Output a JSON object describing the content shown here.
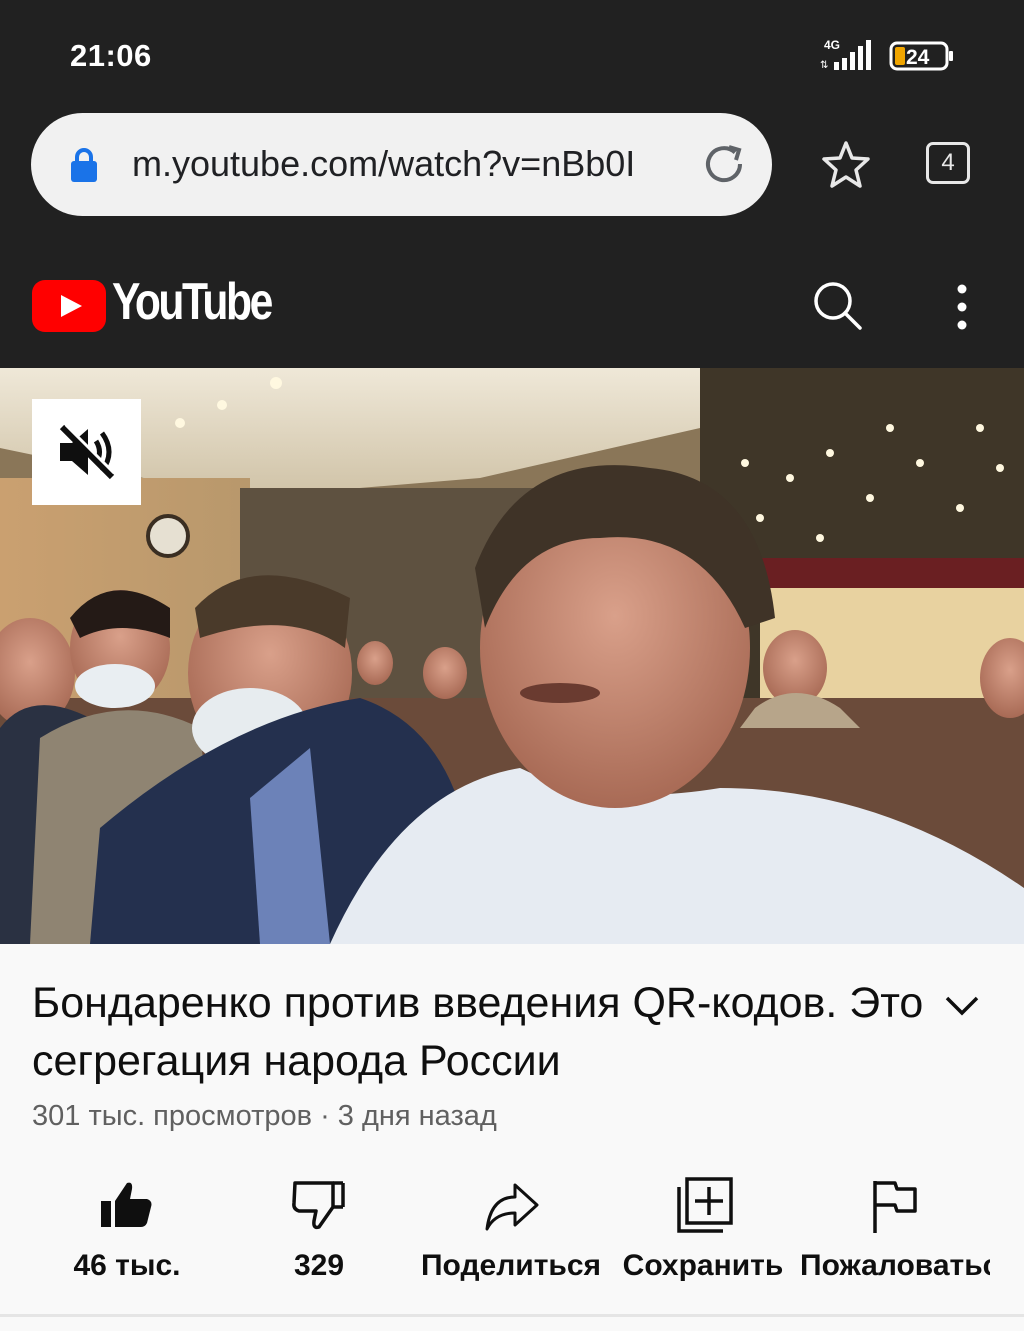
{
  "status": {
    "time": "21:06",
    "network": "4G",
    "battery": "24"
  },
  "browser": {
    "url": "m.youtube.com/watch?v=nBb0I",
    "tab_count": "4"
  },
  "header": {
    "logo_text": "YouTube"
  },
  "video": {
    "title": "Бондаренко против введения QR-кодов. Это сегрегация народа России",
    "meta": "301 тыс. просмотров · 3 дня назад"
  },
  "actions": {
    "like": "46 тыс.",
    "dislike": "329",
    "share": "Поделиться",
    "save": "Сохранить",
    "report": "Пожаловаться"
  },
  "colors": {
    "brand": "#ff0000",
    "chrome_bg": "#212121",
    "omnibox": "#f1f1f1",
    "lock": "#1a73e8"
  }
}
